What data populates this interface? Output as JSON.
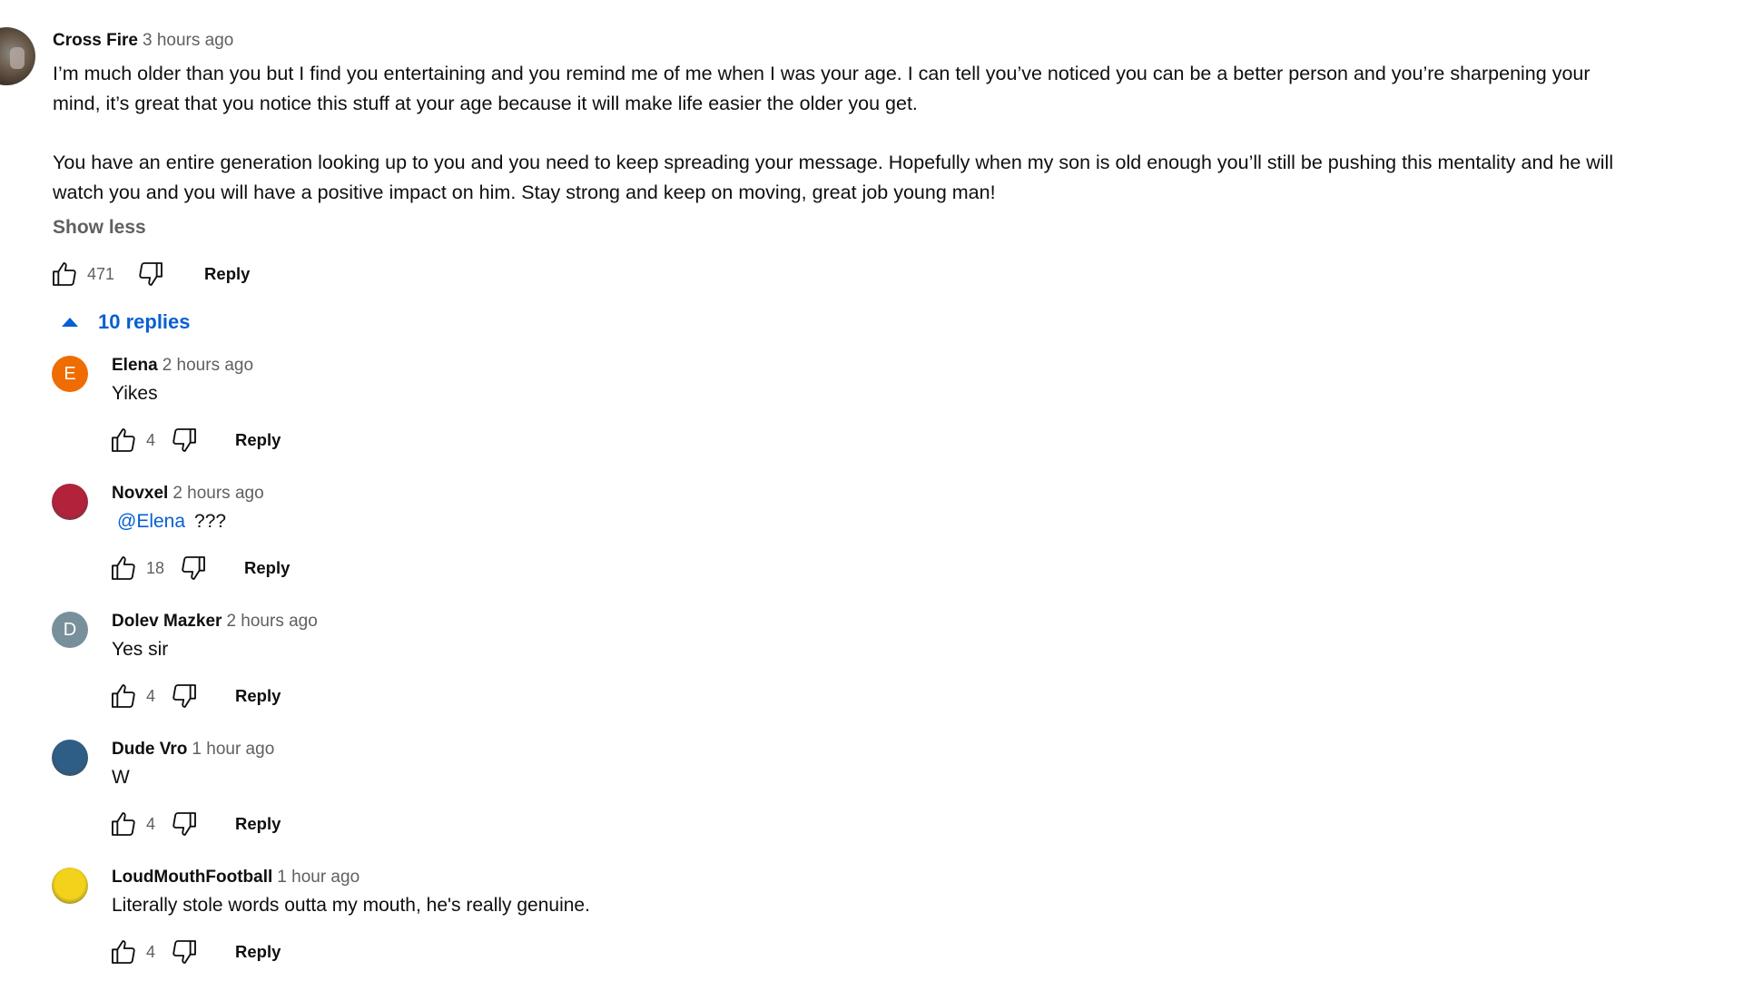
{
  "comment": {
    "author": "Cross Fire",
    "time": "3 hours ago",
    "avatar": "profile-photo-icon",
    "paragraphs": [
      [
        "I’m much older than you but I find you entertaining and you remind me of me when I was your age. I can tell you’ve noticed you can be a better person and you’re sharpening your",
        "mind, it’s great that you notice this stuff at your age because it will make life easier the older you get."
      ],
      [
        "You have an entire generation looking up to you and you need to keep spreading your message. Hopefully when my son is old enough you’ll still be pushing this mentality and he will",
        "watch you and you will have a positive impact on him. Stay strong and keep on moving, great job young man!"
      ]
    ],
    "show_less_label": "Show less",
    "likes": "471",
    "reply_label": "Reply",
    "like_icon": "thumbs-up-icon",
    "dislike_icon": "thumbs-down-icon"
  },
  "replies_toggle": {
    "label": "10 replies",
    "icon": "caret-up-icon",
    "color": "#065fd4"
  },
  "replies": [
    {
      "author": "Elena",
      "time": "2 hours ago",
      "avatar_letter": "E",
      "avatar_color": "#ef6c00",
      "mention": "",
      "text": "Yikes",
      "likes": "4",
      "reply_label": "Reply"
    },
    {
      "author": "Novxel",
      "time": "2 hours ago",
      "avatar_letter": "",
      "avatar_color": "#b2223a",
      "mention": "@Elena",
      "text": "???",
      "likes": "18",
      "reply_label": "Reply"
    },
    {
      "author": "Dolev Mazker",
      "time": "2 hours ago",
      "avatar_letter": "D",
      "avatar_color": "#78909c",
      "mention": "",
      "text": "Yes sir",
      "likes": "4",
      "reply_label": "Reply"
    },
    {
      "author": "Dude Vro",
      "time": "1 hour ago",
      "avatar_letter": "",
      "avatar_color": "#2e5e86",
      "mention": "",
      "text": "W",
      "likes": "4",
      "reply_label": "Reply"
    },
    {
      "author": "LoudMouthFootball",
      "time": "1 hour ago",
      "avatar_letter": "",
      "avatar_color": "#f2d21b",
      "mention": "",
      "text": "Literally stole words outta my mouth, he's really genuine.",
      "likes": "4",
      "reply_label": "Reply"
    }
  ]
}
